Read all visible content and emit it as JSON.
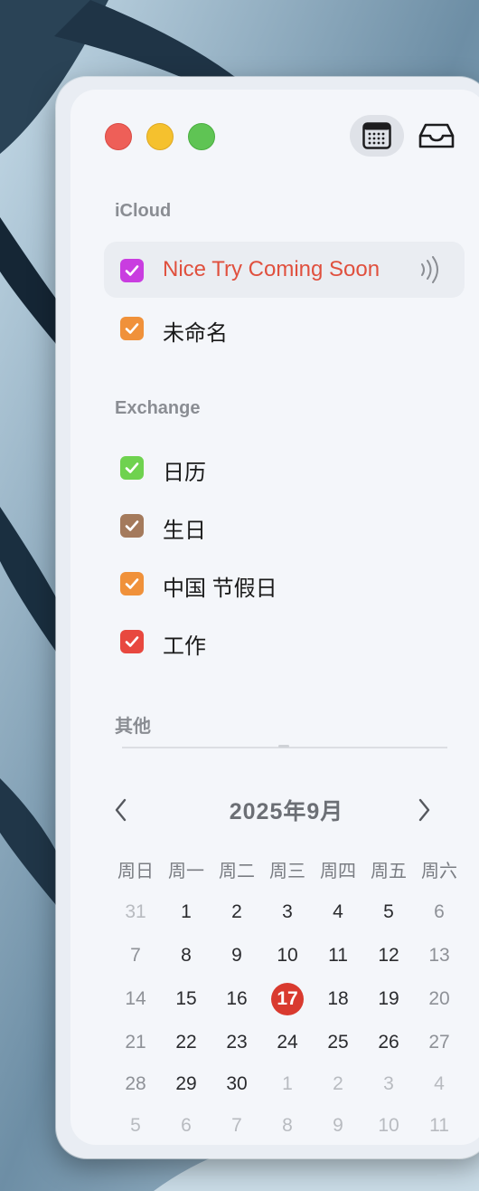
{
  "window": {
    "toolbar": {
      "calendar_icon": "calendar-grid-icon",
      "inbox_icon": "inbox-tray-icon"
    }
  },
  "sidebar": {
    "sections": [
      {
        "title": "iCloud",
        "items": [
          {
            "label": "Nice Try Coming Soon",
            "color": "#c93de0",
            "checked": true,
            "selected": true,
            "icon": "broadcast-icon"
          },
          {
            "label": "未命名",
            "color": "#f0913a",
            "checked": true
          }
        ]
      },
      {
        "title": "Exchange",
        "items": [
          {
            "label": "日历",
            "color": "#6fd24f",
            "checked": true
          },
          {
            "label": "生日",
            "color": "#a47a5c",
            "checked": true
          },
          {
            "label": "中国 节假日",
            "color": "#f0913a",
            "checked": true
          },
          {
            "label": "工作",
            "color": "#e8483f",
            "checked": true
          }
        ]
      },
      {
        "title": "其他",
        "items": []
      }
    ]
  },
  "mini_calendar": {
    "title": "2025年9月",
    "weekdays": [
      "周日",
      "周一",
      "周二",
      "周三",
      "周四",
      "周五",
      "周六"
    ],
    "weeks": [
      [
        "31",
        "1",
        "2",
        "3",
        "4",
        "5",
        "6"
      ],
      [
        "7",
        "8",
        "9",
        "10",
        "11",
        "12",
        "13"
      ],
      [
        "14",
        "15",
        "16",
        "17",
        "18",
        "19",
        "20"
      ],
      [
        "21",
        "22",
        "23",
        "24",
        "25",
        "26",
        "27"
      ],
      [
        "28",
        "29",
        "30",
        "1",
        "2",
        "3",
        "4"
      ],
      [
        "5",
        "6",
        "7",
        "8",
        "9",
        "10",
        "11"
      ]
    ],
    "today": "17",
    "accent_color": "#d93a2f"
  }
}
